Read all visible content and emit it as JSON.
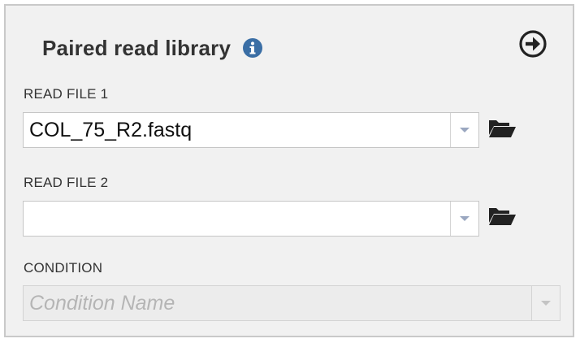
{
  "panel": {
    "title": "Paired read library"
  },
  "read_file_1": {
    "label": "READ FILE 1",
    "value": "COL_75_R2.fastq"
  },
  "read_file_2": {
    "label": "READ FILE 2",
    "value": ""
  },
  "condition": {
    "label": "CONDITION",
    "placeholder": "Condition Name"
  },
  "icons": {
    "info": "info-circle-icon",
    "next": "arrow-circle-right-icon",
    "folder": "folder-open-icon"
  },
  "colors": {
    "info_blue": "#3a6ea5",
    "icon_dark": "#222222",
    "caret": "#9aa7c0"
  }
}
